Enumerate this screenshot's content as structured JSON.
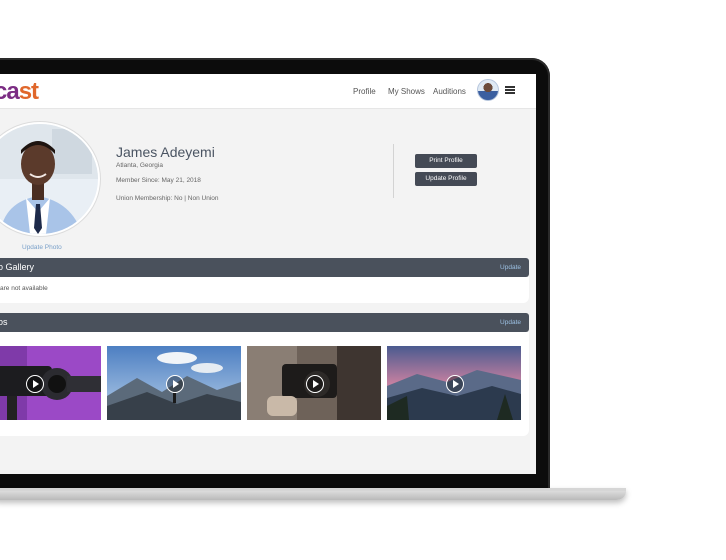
{
  "header": {
    "logo_part1": "ca",
    "logo_part2": "st",
    "nav": [
      "Profile",
      "My Shows",
      "Auditions"
    ]
  },
  "profile": {
    "name": "James Adeyemi",
    "location": "Atlanta, Georgia",
    "member_since": "Member Since: May 21, 2018",
    "union": "Union Membership: No | Non Union",
    "update_photo": "Update Photo",
    "print_button": "Print Profile",
    "update_button": "Update Profile"
  },
  "photo_gallery": {
    "title": "o Gallery",
    "update_label": "Update",
    "empty_text": "are not available"
  },
  "videos": {
    "title": "os",
    "update_label": "Update",
    "thumbnails": [
      "camera-purple",
      "mountain-hiker",
      "camera-closeup",
      "mountain-sunset"
    ]
  },
  "colors": {
    "header_bar": "#4a515c",
    "button": "#444a55",
    "link": "#7aa0c9",
    "logo_purple": "#7b2c83",
    "logo_orange": "#e0672b"
  }
}
